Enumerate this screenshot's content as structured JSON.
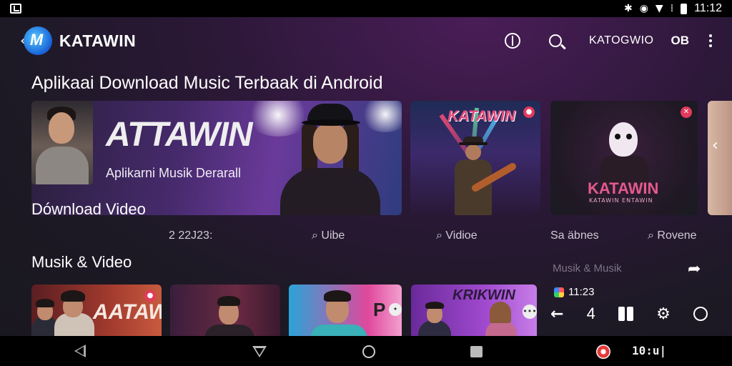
{
  "status_bar": {
    "time": "11:12",
    "icons": [
      "notification-icon",
      "bluetooth-icon",
      "alarm-icon",
      "wifi-icon",
      "signal-icon",
      "battery-icon"
    ]
  },
  "header": {
    "brand": "KATAWIN",
    "label_1": "KATOGWIO",
    "label_2": "OB",
    "icons": [
      "back-icon",
      "app-logo-icon",
      "info-icon",
      "search-icon",
      "more-icon"
    ]
  },
  "sections": {
    "featured_title": "Aplikaai Download Music Terbaak di Android",
    "download_title": "Dównload Video",
    "musik_title": "Musik & Video"
  },
  "hero": {
    "title": "ATTAWIN",
    "subtitle": "Aplikarni Musik Derarall"
  },
  "cards": {
    "card1_logo": "KATAWIN",
    "card2_logo": "KATAWIN",
    "card2_subtitle": "KATAWIN ENTAWIN"
  },
  "meta_row": [
    "2 22J23:",
    "⌕ Uibe",
    "⌕ Vidioe",
    "Sa äbnes",
    "⌕ Rovene"
  ],
  "bottom_cards": {
    "b1_logo": "AATAWIN",
    "b4_logo": "KRIKWIN"
  },
  "mini_player": {
    "label": "Musik & Musik",
    "time": "11:23",
    "number": "4"
  },
  "nav_bar": {
    "text": "10:u|"
  },
  "colors": {
    "background": "#1d1925",
    "accent_pink": "#e44b7e",
    "status_bar": "#000000"
  }
}
